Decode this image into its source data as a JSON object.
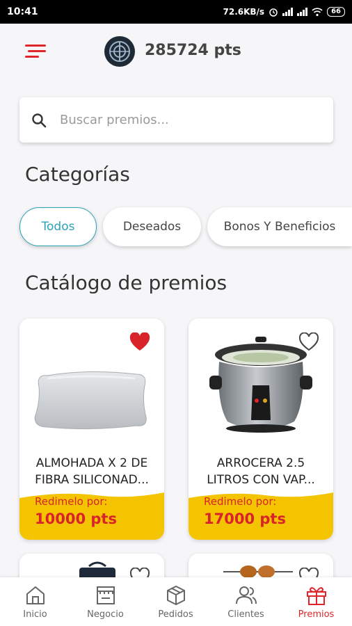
{
  "status_bar": {
    "time": "10:41",
    "speed": "72.6KB/s",
    "battery": "66",
    "icons": [
      "alarm-icon",
      "signal-icon",
      "signal-icon",
      "wifi-icon",
      "battery-icon"
    ]
  },
  "header": {
    "points": "285724 pts",
    "menu_icon": "menu-icon",
    "logo_icon": "brand-logo"
  },
  "search": {
    "placeholder": "Buscar premios...",
    "value": ""
  },
  "categories": {
    "title": "Categorías",
    "items": [
      {
        "label": "Todos",
        "active": true
      },
      {
        "label": "Deseados",
        "active": false
      },
      {
        "label": "Bonos Y Beneficios",
        "active": false
      }
    ]
  },
  "catalog": {
    "title": "Catálogo de premios",
    "products": [
      {
        "name_line1": "ALMOHADA X 2 DE",
        "name_line2": "FIBRA SILICONAD...",
        "redeem_label": "Redimelo por:",
        "price": "10000 pts",
        "favorite": true
      },
      {
        "name_line1": "ARROCERA 2.5",
        "name_line2": "LITROS CON VAP...",
        "redeem_label": "Redimelo por:",
        "price": "17000 pts",
        "favorite": false
      }
    ]
  },
  "colors": {
    "accent": "#e0262b",
    "chip_active": "#2aa3b7",
    "price_band": "#f5c400",
    "price_text": "#d8232a"
  },
  "bottom_nav": {
    "items": [
      {
        "label": "Inicio",
        "icon": "home-icon",
        "active": false
      },
      {
        "label": "Negocio",
        "icon": "store-icon",
        "active": false
      },
      {
        "label": "Pedidos",
        "icon": "box-icon",
        "active": false
      },
      {
        "label": "Clientes",
        "icon": "users-icon",
        "active": false
      },
      {
        "label": "Premios",
        "icon": "gift-icon",
        "active": true
      }
    ]
  }
}
